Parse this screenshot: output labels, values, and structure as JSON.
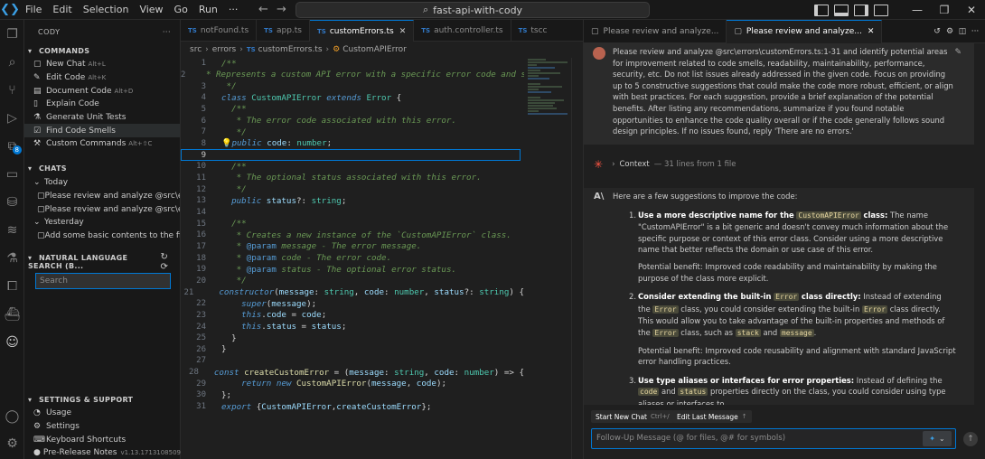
{
  "titlebar": {
    "menu": [
      "File",
      "Edit",
      "Selection",
      "View",
      "Go",
      "Run",
      "···"
    ],
    "command_center": "fast-api-with-cody"
  },
  "activity": {
    "badges": [
      "8"
    ]
  },
  "sidebar": {
    "title": "CODY",
    "commands_title": "COMMANDS",
    "commands": [
      {
        "label": "New Chat",
        "kbd": "Alt+L"
      },
      {
        "label": "Edit Code",
        "kbd": "Alt+K"
      },
      {
        "label": "Document Code",
        "kbd": "Alt+D"
      },
      {
        "label": "Explain Code",
        "kbd": ""
      },
      {
        "label": "Generate Unit Tests",
        "kbd": ""
      },
      {
        "label": "Find Code Smells",
        "kbd": ""
      },
      {
        "label": "Custom Commands",
        "kbd": "Alt+⇧C"
      }
    ],
    "chats_title": "CHATS",
    "today_label": "Today",
    "today_chats": [
      "Please review and analyze @src\\e...",
      "Please review and analyze @src\\e..."
    ],
    "yesterday_label": "Yesterday",
    "yesterday_chats": [
      "Add some basic contents to the fi..."
    ],
    "nl_search_title": "NATURAL LANGUAGE SEARCH (B...",
    "search_placeholder": "Search",
    "settings_title": "SETTINGS & SUPPORT",
    "settings_items": [
      "Usage",
      "Settings",
      "Keyboard Shortcuts"
    ],
    "release_label": "Pre-Release Notes",
    "release_version": "v1.13.1713108509"
  },
  "editor": {
    "tabs": [
      "notFound.ts",
      "app.ts",
      "customErrors.ts",
      "auth.controller.ts",
      "tscc"
    ],
    "active_tab": 2,
    "breadcrumb": [
      "src",
      "errors",
      "customErrors.ts",
      "CustomAPIError"
    ],
    "current_line": 9
  },
  "chat": {
    "tabs": [
      "Please review and analyze...",
      "Please review and analyze..."
    ],
    "human_message": "Please review and analyze @src\\errors\\customErrors.ts:1-31 and identify potential areas for improvement related to code smells, readability, maintainability, performance, security, etc. Do not list issues already addressed in the given code. Focus on providing up to 5 constructive suggestions that could make the code more robust, efficient, or align with best practices. For each suggestion, provide a brief explanation of the potential benefits. After listing any recommendations, summarize if you found notable opportunities to enhance the code quality overall or if the code generally follows sound design principles. If no issues found, reply 'There are no errors.'",
    "context_label": "Context",
    "context_detail": "— 31 lines from 1 file",
    "assistant_intro": "Here are a few suggestions to improve the code:",
    "s1_num": "1.",
    "s1_title": "Use a more descriptive name for the",
    "s1_code": "CustomAPIError",
    "s1_title2": "class:",
    "s1_body": "The name \"CustomAPIError\" is a bit generic and doesn't convey much information about the specific purpose or context of this error class. Consider using a more descriptive name that better reflects the domain or use case of this error.",
    "s1_benefit": "Potential benefit: Improved code readability and maintainability by making the purpose of the class more explicit.",
    "s2_num": "2.",
    "s2_title": "Consider extending the built-in",
    "s2_code": "Error",
    "s2_title2": "class directly:",
    "s2_body_a": "Instead of extending the",
    "s2_code_b": "Error",
    "s2_body_b": "class, you could consider extending the built-in",
    "s2_code_c": "Error",
    "s2_body_c": "class directly. This would allow you to take advantage of the built-in properties and methods of the",
    "s2_code_d": "Error",
    "s2_body_d": "class, such as",
    "s2_code_e": "stack",
    "s2_body_e": "and",
    "s2_code_f": "message",
    "s2_body_f": ".",
    "s2_benefit": "Potential benefit: Improved code reusability and alignment with standard JavaScript error handling practices.",
    "s3_num": "3.",
    "s3_title": "Use type aliases or interfaces for error properties:",
    "s3_body_a": "Instead of defining the",
    "s3_code_a": "code",
    "s3_body_b": "and",
    "s3_code_b": "status",
    "s3_body_c": "properties directly on the class, you could consider using type aliases or interfaces to",
    "start_new_chat": "Start New Chat",
    "start_new_chat_kbd": "Ctrl+/",
    "edit_last_message": "Edit Last Message",
    "edit_last_message_kbd": "↑",
    "input_placeholder": "Follow-Up Message (@ for files, @# for symbols)"
  },
  "code_lines": [
    {
      "n": "1",
      "segs": [
        [
          "/**",
          "comment"
        ]
      ]
    },
    {
      "n": "2",
      "segs": [
        [
          " * Represents a custom API error with a specific error code and s",
          "comment"
        ]
      ]
    },
    {
      "n": "3",
      "segs": [
        [
          " */",
          "comment"
        ]
      ]
    },
    {
      "n": "4",
      "segs": [
        [
          "class ",
          "keyword"
        ],
        [
          "CustomAPIError ",
          "class"
        ],
        [
          "extends ",
          "keyword"
        ],
        [
          "Error",
          "class"
        ],
        [
          " {",
          "text"
        ]
      ]
    },
    {
      "n": "5",
      "segs": [
        [
          "  /**",
          "comment"
        ]
      ]
    },
    {
      "n": "6",
      "segs": [
        [
          "   * The error code associated with this error.",
          "comment"
        ]
      ]
    },
    {
      "n": "7",
      "segs": [
        [
          "   */",
          "comment"
        ]
      ]
    },
    {
      "n": "8",
      "segs": [
        [
          "💡",
          "text"
        ],
        [
          "public ",
          "keyword"
        ],
        [
          "code",
          "prop"
        ],
        [
          ": ",
          "text"
        ],
        [
          "number",
          "type"
        ],
        [
          ";",
          "text"
        ]
      ]
    },
    {
      "n": "9",
      "segs": [
        [
          "",
          "text"
        ]
      ]
    },
    {
      "n": "10",
      "segs": [
        [
          "  /**",
          "comment"
        ]
      ]
    },
    {
      "n": "11",
      "segs": [
        [
          "   * The optional status associated with this error.",
          "comment"
        ]
      ]
    },
    {
      "n": "12",
      "segs": [
        [
          "   */",
          "comment"
        ]
      ]
    },
    {
      "n": "13",
      "segs": [
        [
          "  public ",
          "keyword"
        ],
        [
          "status",
          "prop"
        ],
        [
          "?: ",
          "text"
        ],
        [
          "string",
          "type"
        ],
        [
          ";",
          "text"
        ]
      ]
    },
    {
      "n": "14",
      "segs": [
        [
          "",
          "text"
        ]
      ]
    },
    {
      "n": "15",
      "segs": [
        [
          "  /**",
          "comment"
        ]
      ]
    },
    {
      "n": "16",
      "segs": [
        [
          "   * Creates a new instance of the `CustomAPIError` class.",
          "comment"
        ]
      ]
    },
    {
      "n": "17",
      "segs": [
        [
          "   * ",
          "comment"
        ],
        [
          "@param",
          "tag"
        ],
        [
          " message - The error message.",
          "comment"
        ]
      ]
    },
    {
      "n": "18",
      "segs": [
        [
          "   * ",
          "comment"
        ],
        [
          "@param",
          "tag"
        ],
        [
          " code - The error code.",
          "comment"
        ]
      ]
    },
    {
      "n": "19",
      "segs": [
        [
          "   * ",
          "comment"
        ],
        [
          "@param",
          "tag"
        ],
        [
          " status - The optional error status.",
          "comment"
        ]
      ]
    },
    {
      "n": "20",
      "segs": [
        [
          "   */",
          "comment"
        ]
      ]
    },
    {
      "n": "21",
      "segs": [
        [
          "  constructor",
          "keyword"
        ],
        [
          "(",
          "text"
        ],
        [
          "message",
          "prop"
        ],
        [
          ": ",
          "text"
        ],
        [
          "string",
          "type"
        ],
        [
          ", ",
          "text"
        ],
        [
          "code",
          "prop"
        ],
        [
          ": ",
          "text"
        ],
        [
          "number",
          "type"
        ],
        [
          ", ",
          "text"
        ],
        [
          "status",
          "prop"
        ],
        [
          "?: ",
          "text"
        ],
        [
          "string",
          "type"
        ],
        [
          ") {",
          "text"
        ]
      ]
    },
    {
      "n": "22",
      "segs": [
        [
          "    super",
          "keyword"
        ],
        [
          "(",
          "text"
        ],
        [
          "message",
          "prop"
        ],
        [
          ");",
          "text"
        ]
      ]
    },
    {
      "n": "23",
      "segs": [
        [
          "    this",
          "keyword"
        ],
        [
          ".",
          "text"
        ],
        [
          "code",
          "prop"
        ],
        [
          " = ",
          "text"
        ],
        [
          "code",
          "prop"
        ],
        [
          ";",
          "text"
        ]
      ]
    },
    {
      "n": "24",
      "segs": [
        [
          "    this",
          "keyword"
        ],
        [
          ".",
          "text"
        ],
        [
          "status",
          "prop"
        ],
        [
          " = ",
          "text"
        ],
        [
          "status",
          "prop"
        ],
        [
          ";",
          "text"
        ]
      ]
    },
    {
      "n": "25",
      "segs": [
        [
          "  }",
          "text"
        ]
      ]
    },
    {
      "n": "26",
      "segs": [
        [
          "}",
          "text"
        ]
      ]
    },
    {
      "n": "27",
      "segs": [
        [
          "",
          "text"
        ]
      ]
    },
    {
      "n": "28",
      "segs": [
        [
          "const ",
          "keyword"
        ],
        [
          "createCustomError",
          "func"
        ],
        [
          " = (",
          "text"
        ],
        [
          "message",
          "prop"
        ],
        [
          ": ",
          "text"
        ],
        [
          "string",
          "type"
        ],
        [
          ", ",
          "text"
        ],
        [
          "code",
          "prop"
        ],
        [
          ": ",
          "text"
        ],
        [
          "number",
          "type"
        ],
        [
          ") => {",
          "text"
        ]
      ]
    },
    {
      "n": "29",
      "segs": [
        [
          "    return new ",
          "keyword"
        ],
        [
          "CustomAPIError",
          "func"
        ],
        [
          "(",
          "text"
        ],
        [
          "message",
          "prop"
        ],
        [
          ", ",
          "text"
        ],
        [
          "code",
          "prop"
        ],
        [
          ");",
          "text"
        ]
      ]
    },
    {
      "n": "30",
      "segs": [
        [
          "};",
          "text"
        ]
      ]
    },
    {
      "n": "31",
      "segs": [
        [
          "export ",
          "keyword"
        ],
        [
          "{",
          "text"
        ],
        [
          "CustomAPIError",
          "prop"
        ],
        [
          ",",
          "text"
        ],
        [
          "createCustomError",
          "prop"
        ],
        [
          "};",
          "text"
        ]
      ]
    }
  ]
}
